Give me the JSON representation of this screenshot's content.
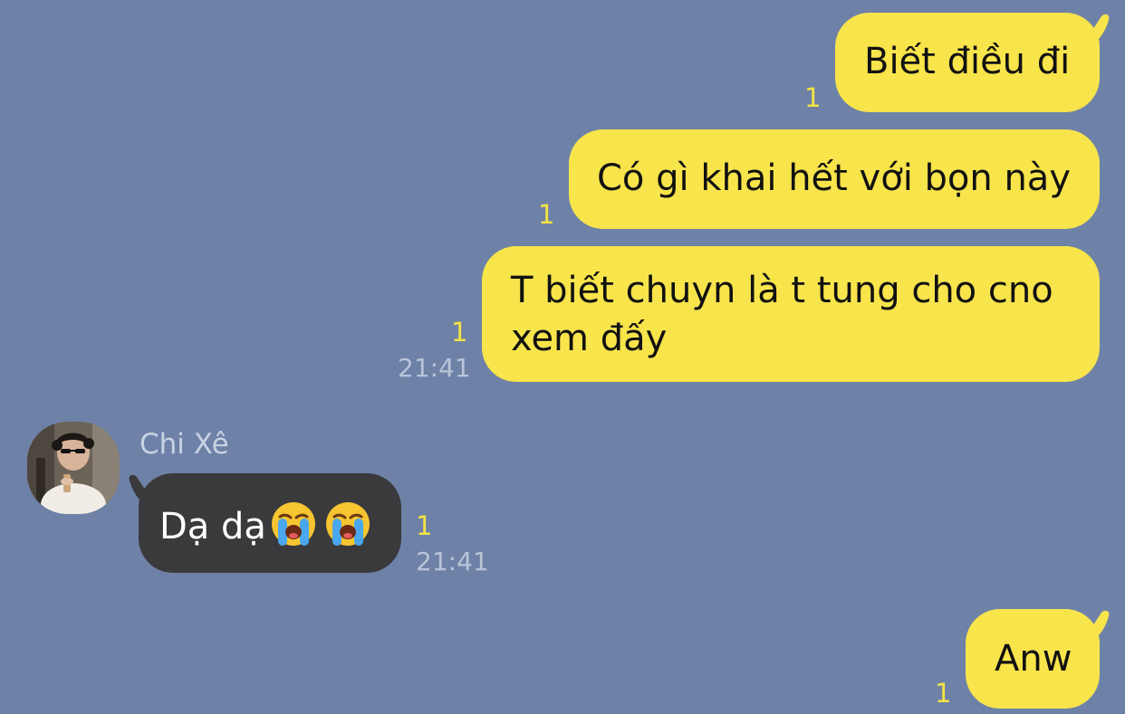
{
  "messages": {
    "m1": {
      "text": "Biết điều đi",
      "unread": "1"
    },
    "m2": {
      "text": "Có gì khai hết với bọn này",
      "unread": "1"
    },
    "m3": {
      "text": "T biết chuyn là t tung cho cno xem đấy",
      "unread": "1",
      "time": "21:41"
    },
    "m4": {
      "sender": "Chi Xê",
      "text": "Dạ dạ",
      "emoji": "loudly-crying-face-icon",
      "unread": "1",
      "time": "21:41"
    },
    "m5": {
      "text": "Anw",
      "unread": "1"
    }
  },
  "colors": {
    "background": "#6e82a8",
    "outgoing_bubble": "#f8e44b",
    "incoming_bubble": "#3a3a3c",
    "unread_count": "#f3e344",
    "timestamp": "#b9c4d8"
  }
}
